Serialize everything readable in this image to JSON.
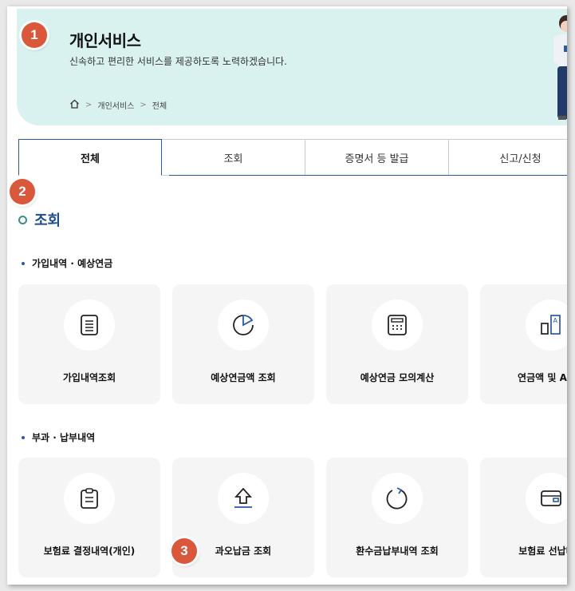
{
  "header": {
    "title": "개인서비스",
    "description": "신속하고 편리한 서비스를 제공하도록 노력하겠습니다.",
    "breadcrumb": [
      "개인서비스",
      "전체"
    ]
  },
  "tabs": [
    "전체",
    "조회",
    "증명서 등 발급",
    "신고/신청"
  ],
  "section": {
    "title": "조회",
    "groups": [
      {
        "title": "가입내역 · 예상연금",
        "items": [
          {
            "label": "가입내역조회",
            "icon": "document-list-icon"
          },
          {
            "label": "예상연금액 조회",
            "icon": "pie-chart-icon"
          },
          {
            "label": "예상연금 모의계산",
            "icon": "calculator-icon"
          },
          {
            "label": "연금액 및 A급여",
            "icon": "bar-a-icon"
          }
        ]
      },
      {
        "title": "부과 · 납부내역",
        "items": [
          {
            "label": "보험료 결정내역(개인)",
            "icon": "clipboard-icon"
          },
          {
            "label": "과오납금 조회",
            "icon": "arrow-up-icon"
          },
          {
            "label": "환수금납부내역 조회",
            "icon": "refresh-icon"
          },
          {
            "label": "보험료 선납내역",
            "icon": "wallet-icon"
          }
        ]
      }
    ]
  },
  "badges": [
    "1",
    "2",
    "3"
  ],
  "colors": {
    "accent": "#2a5aa6",
    "hero_bg": "#d9f1ef",
    "badge": "#d9573a",
    "card_bg": "#f5f5f6"
  }
}
